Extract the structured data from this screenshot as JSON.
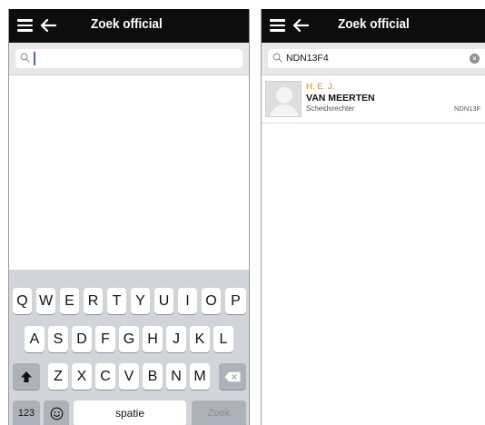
{
  "screens": [
    {
      "header": {
        "title": "Zoek official",
        "menu_icon": "hamburger-icon",
        "back_icon": "arrow-left-icon"
      },
      "search": {
        "value": "",
        "placeholder": "",
        "icon": "search-icon"
      },
      "keyboard": {
        "row1": [
          "Q",
          "W",
          "E",
          "R",
          "T",
          "Y",
          "U",
          "I",
          "O",
          "P"
        ],
        "row2": [
          "A",
          "S",
          "D",
          "F",
          "G",
          "H",
          "J",
          "K",
          "L"
        ],
        "row3": [
          "Z",
          "X",
          "C",
          "V",
          "B",
          "N",
          "M"
        ],
        "shift_icon": "shift-icon",
        "backspace_icon": "backspace-icon",
        "numbers_label": "123",
        "emoji_icon": "emoji-icon",
        "space_label": "spatie",
        "search_label": "Zoek"
      }
    },
    {
      "header": {
        "title": "Zoek official",
        "menu_icon": "hamburger-icon",
        "back_icon": "arrow-left-icon"
      },
      "search": {
        "value": "NDN13F4",
        "icon": "search-icon",
        "clear_icon": "clear-icon"
      },
      "results": [
        {
          "initials": "H. E. J.",
          "surname": "VAN MEERTEN",
          "role": "Scheidsrechter",
          "relation": "NDN13F",
          "avatar_icon": "user-placeholder-icon"
        }
      ]
    }
  ],
  "colors": {
    "header_bg": "#0d0d0d",
    "accent_orange": "#e9893a",
    "caret_blue": "#2f6fe0",
    "keyboard_bg": "#d1d4d9",
    "special_key": "#adb2ba"
  }
}
